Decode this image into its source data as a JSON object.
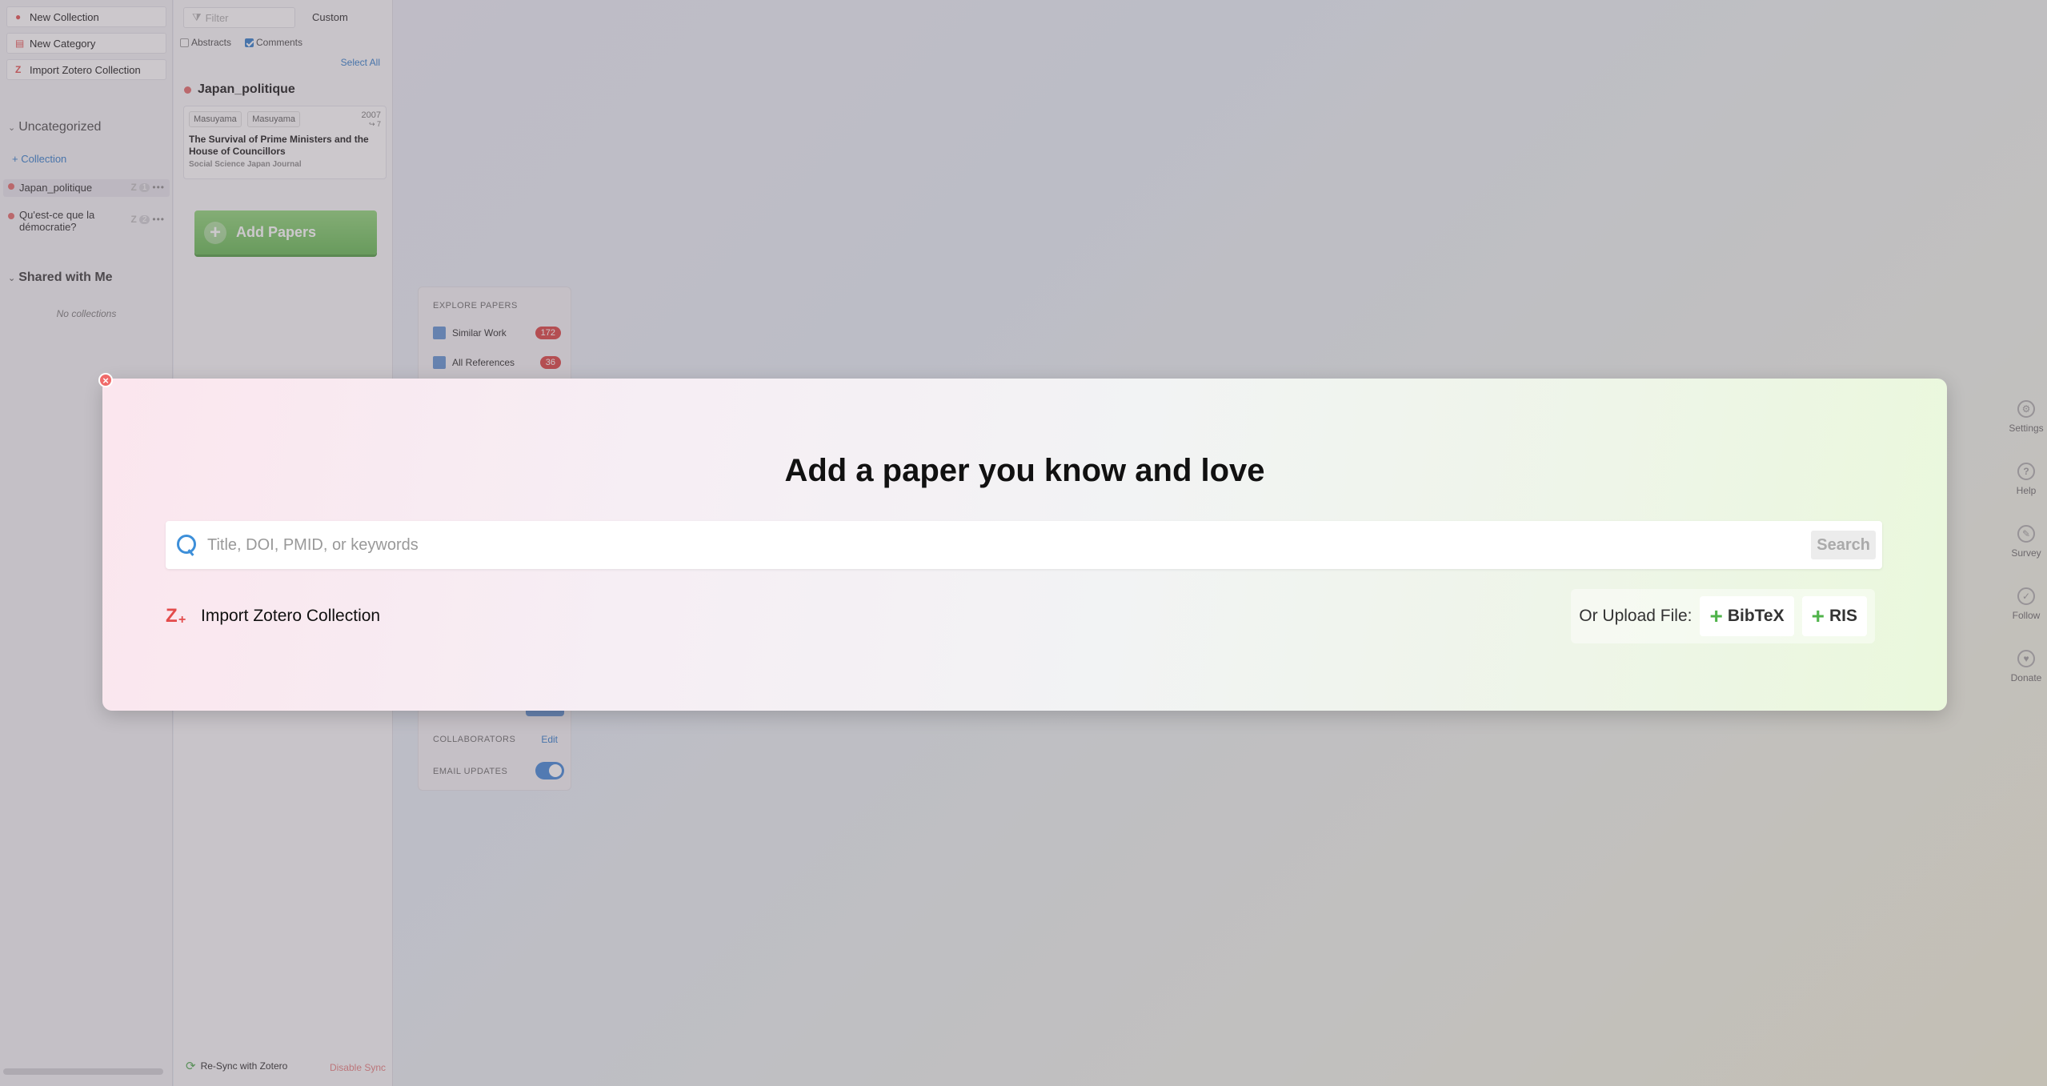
{
  "sidebar": {
    "buttons": [
      {
        "label": "New Collection",
        "icon": "new-collection-icon"
      },
      {
        "label": "New Category",
        "icon": "new-category-icon"
      },
      {
        "label": "Import Zotero Collection",
        "icon": "zotero-icon"
      }
    ],
    "uncategorized_heading": "Uncategorized",
    "add_collection_label": "+ Collection",
    "collections": [
      {
        "name": "Japan_politique",
        "count": "1"
      },
      {
        "name": "Qu'est-ce que la démocratie?",
        "count": "2"
      }
    ],
    "shared_heading": "Shared with Me",
    "no_collections_text": "No collections"
  },
  "papers_panel": {
    "filter_placeholder": "Filter",
    "sort_label": "Custom",
    "abstracts_label": "Abstracts",
    "comments_label": "Comments",
    "select_all_label": "Select All",
    "collection_title": "Japan_politique",
    "paper": {
      "authors": [
        "Masuyama",
        "Masuyama"
      ],
      "year": "2007",
      "year_sub": "↪ 7",
      "title": "The Survival of Prime Ministers and the House of Councillors",
      "journal": "Social Science Japan Journal"
    },
    "add_papers_label": "Add Papers",
    "resync_label": "Re-Sync with Zotero",
    "disable_sync_label": "Disable Sync"
  },
  "explore": {
    "heading": "EXPLORE PAPERS",
    "items": [
      {
        "label": "Similar Work",
        "count": "172"
      },
      {
        "label": "All References",
        "count": "36"
      }
    ],
    "collaborators_label": "COLLABORATORS",
    "edit_label": "Edit",
    "email_updates_label": "EMAIL UPDATES"
  },
  "right_rail": [
    {
      "label": "Settings",
      "icon": "gear-icon",
      "glyph": "⚙"
    },
    {
      "label": "Help",
      "icon": "help-icon",
      "glyph": "?"
    },
    {
      "label": "Survey",
      "icon": "survey-icon",
      "glyph": "✎"
    },
    {
      "label": "Follow",
      "icon": "follow-icon",
      "glyph": "✓"
    },
    {
      "label": "Donate",
      "icon": "donate-icon",
      "glyph": "♥"
    }
  ],
  "modal": {
    "close_glyph": "×",
    "title": "Add a paper you know and love",
    "search_placeholder": "Title, DOI, PMID, or keywords",
    "search_button": "Search",
    "zotero_import_label": "Import Zotero Collection",
    "upload_label": "Or Upload File:",
    "upload_buttons": [
      "BibTeX",
      "RIS"
    ]
  },
  "colors": {
    "accent_blue": "#2a78c8",
    "accent_red": "#e34b4b",
    "accent_green": "#5fb64c"
  }
}
